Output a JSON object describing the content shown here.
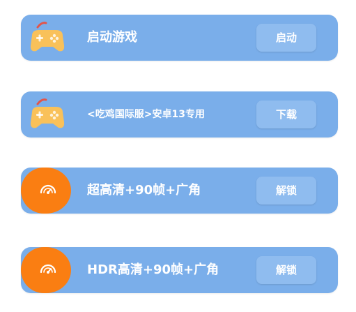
{
  "rows": [
    {
      "icon": "gamepad-icon",
      "title": "启动游戏",
      "button": "启动"
    },
    {
      "icon": "gamepad-icon",
      "title": "<吃鸡国际服>安卓13专用",
      "button": "下载"
    },
    {
      "icon": "gauge-icon",
      "title": "超高清+90帧+广角",
      "button": "解锁"
    },
    {
      "icon": "gauge-icon",
      "title": "HDR高清+90帧+广角",
      "button": "解锁"
    }
  ],
  "colors": {
    "card": "#7aaeea",
    "button": "#8fbcef",
    "gamepad": "#f9c15a",
    "gauge_bg": "#fa7e12"
  }
}
